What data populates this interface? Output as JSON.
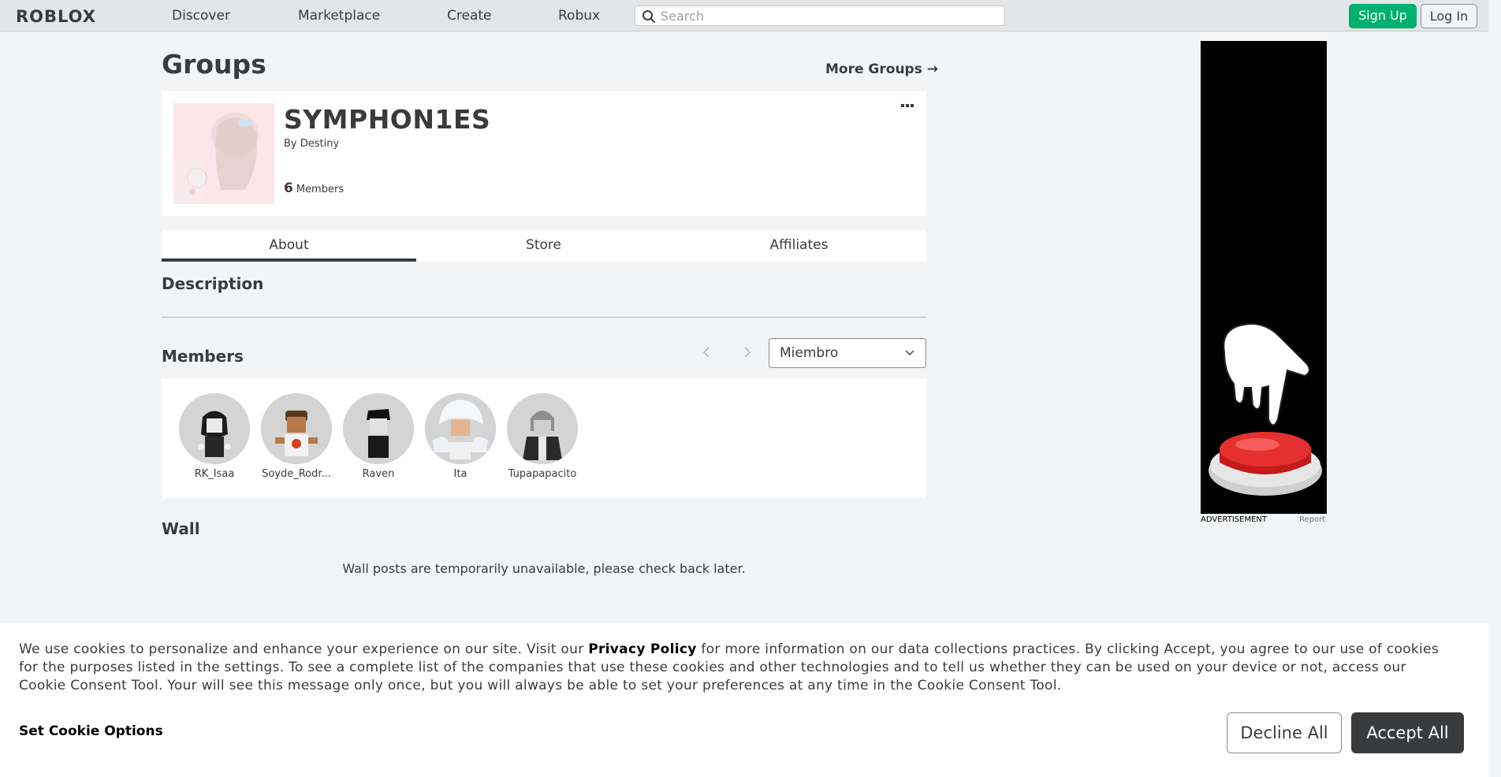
{
  "nav": {
    "logo": "ROBLOX",
    "links": [
      "Discover",
      "Marketplace",
      "Create",
      "Robux"
    ],
    "search_placeholder": "Search",
    "signup_label": "Sign Up",
    "login_label": "Log In"
  },
  "page": {
    "title": "Groups",
    "more_groups": "More Groups →"
  },
  "group": {
    "name": "SYMPHON1ES",
    "by_label": "By",
    "owner": "Destiny",
    "member_count": "6",
    "members_label": "Members"
  },
  "tabs": [
    "About",
    "Store",
    "Affiliates"
  ],
  "sections": {
    "description": "Description",
    "members": "Members",
    "wall": "Wall"
  },
  "members": {
    "role_selected": "Miembro",
    "list": [
      "RK_Isaa",
      "Soyde_Rodr...",
      "Raven",
      "Ita",
      "Tupapapacito"
    ]
  },
  "wall": {
    "message": "Wall posts are temporarily unavailable, please check back later."
  },
  "ad": {
    "label": "ADVERTISEMENT",
    "report": "Report"
  },
  "cookie": {
    "text_before": "We use cookies to personalize and enhance your experience on our site. Visit our ",
    "privacy_link": "Privacy Policy",
    "text_after": " for more information on our data collections practices. By clicking Accept, you agree to our use of cookies for the purposes listed in the settings. To see a complete list of the companies that use these cookies and other technologies and to tell us whether they can be used on your device or not, access our Cookie Consent Tool. Your will see this message only once, but you will always be able to set your preferences at any time in the Cookie Consent Tool.",
    "options_label": "Set Cookie Options",
    "decline_label": "Decline All",
    "accept_label": "Accept All"
  },
  "colors": {
    "signup_green": "#00b06f",
    "text_dark": "#393b3d",
    "page_bg": "#f2f4f5"
  }
}
